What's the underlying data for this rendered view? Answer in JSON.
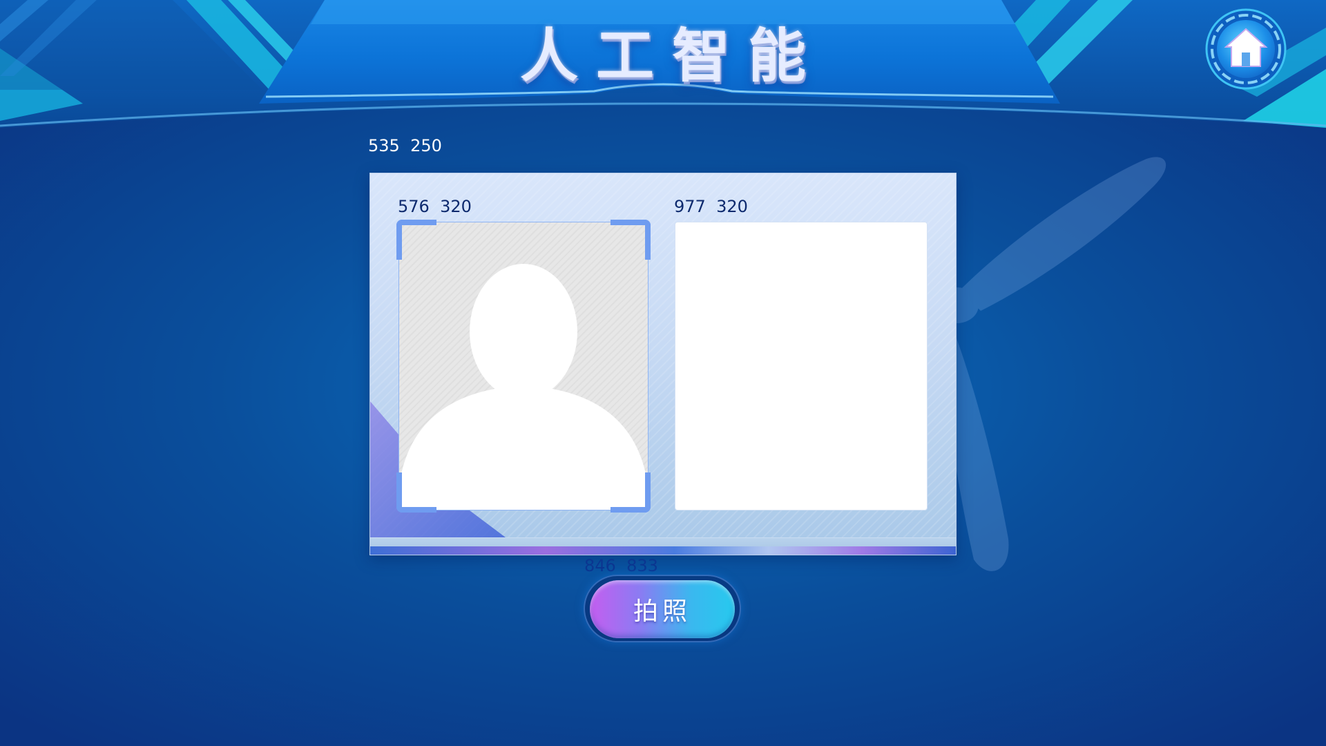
{
  "header": {
    "title": "人工智能",
    "home_icon": "home-icon"
  },
  "coords": {
    "top": "535  250",
    "left_frame": "576  320",
    "right_frame": "977  320",
    "button": "846  833"
  },
  "panel": {
    "placeholder_icon": "person-silhouette-icon"
  },
  "actions": {
    "capture_label": "拍照"
  },
  "colors": {
    "background": "#0a4f9c",
    "header": "#0b78d8",
    "accent_cyan": "#1fd0e6",
    "corner_brackets": "#6f9cf0",
    "button_gradient_start": "#c45ef0",
    "button_gradient_end": "#27c9ee"
  }
}
